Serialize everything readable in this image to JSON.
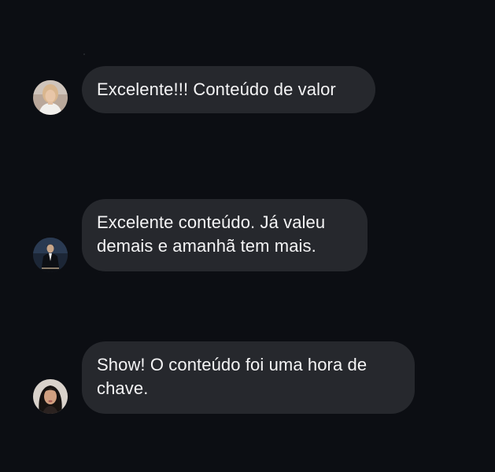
{
  "comments": [
    {
      "author_avatar": "avatar-woman-light-hair",
      "text_lines": [
        "Excelente!!! Conteúdo de valor"
      ]
    },
    {
      "author_avatar": "avatar-man-dark-suit",
      "text_lines": [
        "Excelente conteúdo. Já valeu",
        "demais e amanhã tem mais."
      ]
    },
    {
      "author_avatar": "avatar-woman-dark-hair",
      "text_lines": [
        "Show! O conteúdo foi uma hora de",
        "chave."
      ]
    }
  ],
  "colors": {
    "background": "#0c0e13",
    "bubble": "#26282d",
    "text": "#f4f4f5"
  }
}
